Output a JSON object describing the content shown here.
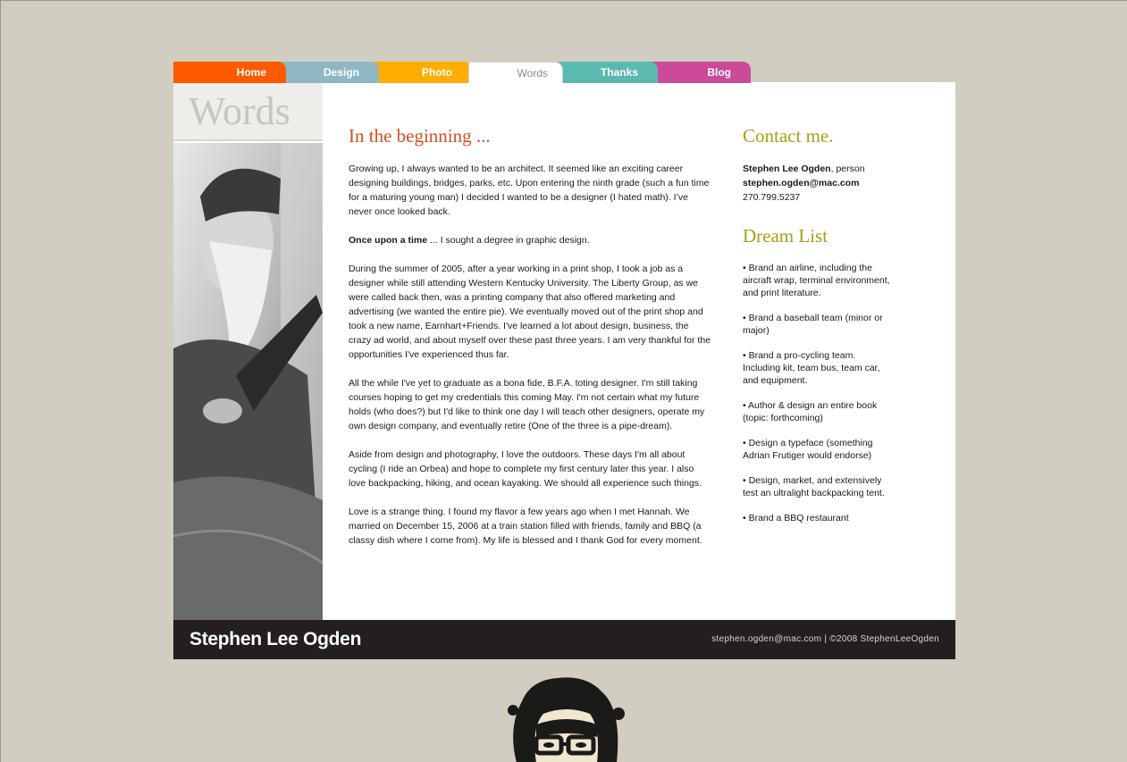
{
  "nav": {
    "tabs": [
      {
        "label": "Home",
        "color": "#ff5a00"
      },
      {
        "label": "Design",
        "color": "#8fb7c3"
      },
      {
        "label": "Photo",
        "color": "#ffae00"
      },
      {
        "label": "Words",
        "color": "#ffffff",
        "active": true
      },
      {
        "label": "Thanks",
        "color": "#5bbab0"
      },
      {
        "label": "Blog",
        "color": "#cc4a9a"
      }
    ]
  },
  "sidebar": {
    "title": "Words"
  },
  "main": {
    "heading": "In the beginning ...",
    "p1": "Growing up, I always wanted to be an architect. It seemed like an exciting career designing buildings, bridges, parks, etc. Upon entering the ninth grade (such a fun time for a maturing young man) I decided I wanted to be a designer (I hated math). I’ve never once looked back.",
    "p2_bold": "Once upon a time",
    "p2_rest": " ... I sought a degree in graphic design.",
    "p3": "During the summer of 2005, after a year working in a print shop, I took a job as a designer while still attending Western Kentucky University. The Liberty Group, as we were called back then, was a printing company that also offered marketing and advertising (we wanted the entire pie). We eventually moved out of the print shop and took a new name, Earnhart+Friends. I've learned a lot about design, business, the crazy ad world, and about myself over these past three years. I am very thankful for the opportunities I've experienced thus far.",
    "p4": "All the while I've yet to graduate as a bona fide, B.F.A. toting designer. I'm still taking courses hoping to get my credentials this coming May. I'm not certain what my future holds (who does?) but I'd like to think one day I will teach other designers, operate my own design company, and eventually retire (One of the three is a pipe-dream).",
    "p5": "Aside from design and photography, I love the outdoors. These days I'm all about cycling (I ride an Orbea) and hope to complete my first century later this year. I also love backpacking, hiking, and ocean kayaking. We should all experience such things.",
    "p6": "Love is a strange thing. I found my flavor a few years ago when I met Hannah. We married on December 15, 2006 at a train station filled with friends, family and BBQ (a classy dish where I come from). My life is blessed and I thank God for every moment."
  },
  "aside": {
    "contact_heading": "Contact me.",
    "contact_name": "Stephen Lee Ogden",
    "contact_role": ", person",
    "contact_email": "stephen.ogden@mac.com",
    "contact_phone": "270.799.5237",
    "dream_heading": "Dream List",
    "dreams": [
      "• Brand an airline, including the aircraft wrap, terminal environment, and print literature.",
      "• Brand a baseball team (minor or major)",
      "• Brand a pro-cycling team. Including kit, team bus, team car, and equipment.",
      "• Author & design an entire book (topic: forthcoming)",
      "• Design a typeface (something Adrian Frutiger would endorse)",
      "• Design, market, and extensively test an ultralight backpacking tent.",
      "• Brand a BBQ restaurant"
    ]
  },
  "footer": {
    "name": "Stephen Lee Ogden",
    "email": "stephen.ogden@mac.com",
    "separator": " | ",
    "copyright": "©2008 StephenLeeOgden"
  }
}
